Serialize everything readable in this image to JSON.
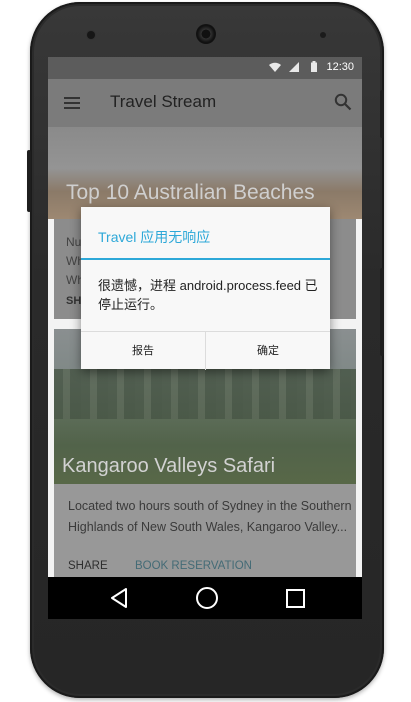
{
  "status_bar": {
    "time": "12:30",
    "icons": [
      "wifi-icon",
      "signal-icon",
      "battery-icon"
    ]
  },
  "app_bar": {
    "title": "Travel Stream",
    "menu_icon": "menu-icon",
    "search_icon": "search-icon"
  },
  "cards": [
    {
      "title": "Top 10 Australian Beaches",
      "text_lines": [
        "Nu",
        "Wh",
        "Wh"
      ],
      "share": "SHAR"
    },
    {
      "title": "Kangaroo Valleys Safari",
      "description": "Located two hours south of Sydney in the Southern Highlands of New South Wales, Kangaroo Valley...",
      "share": "SHARE",
      "book": "BOOK RESERVATION"
    }
  ],
  "dialog": {
    "title": "Travel 应用无响应",
    "message": "很遗憾，进程 android.process.feed 已停止运行。",
    "left_button": "报告",
    "right_button": "确定"
  },
  "colors": {
    "accent": "#2da8d8",
    "dialog_bg": "#f8f8f8"
  }
}
